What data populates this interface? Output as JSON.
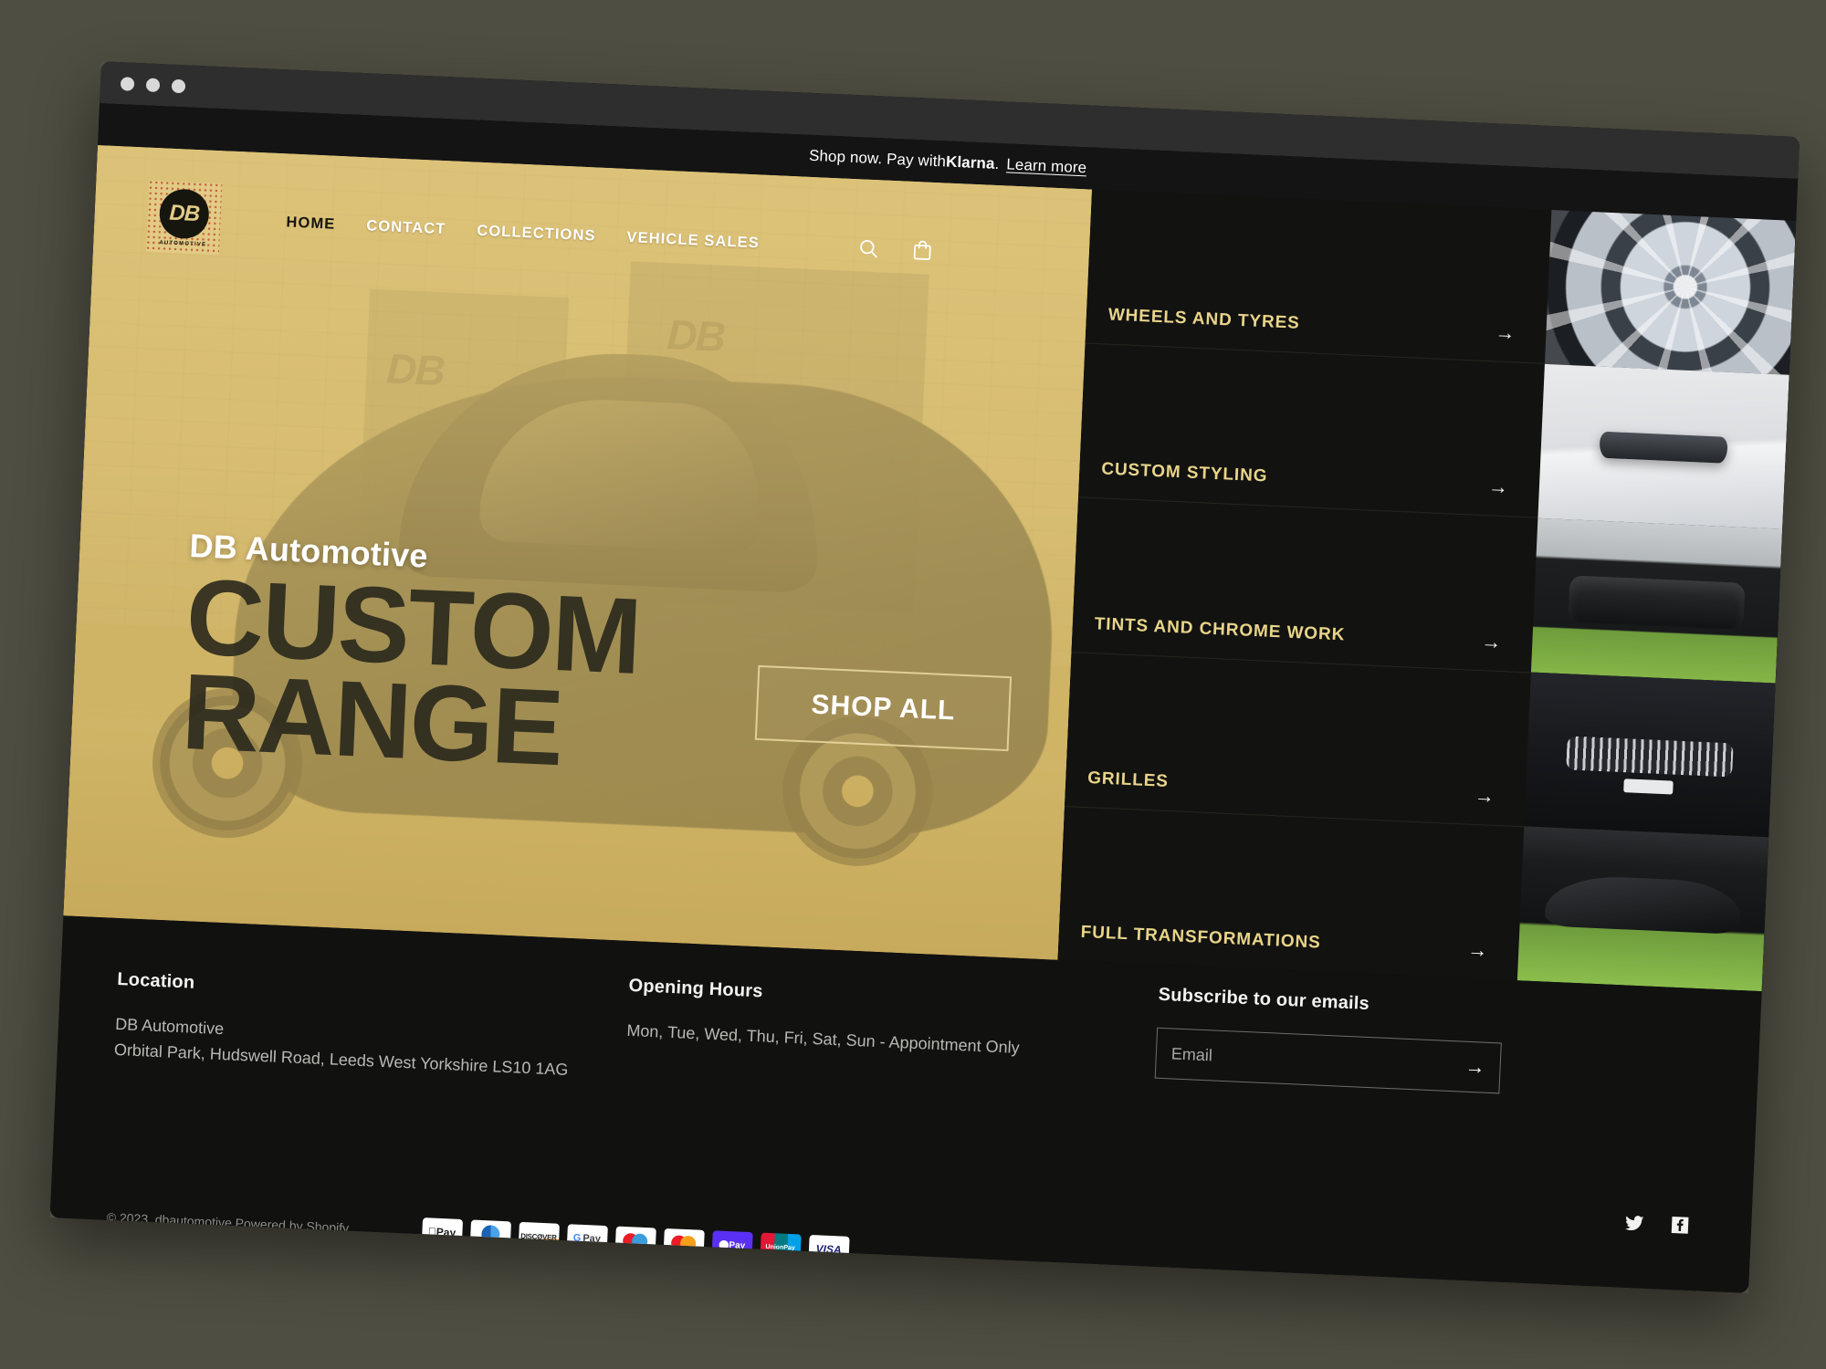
{
  "announcement": {
    "text_before": "Shop now. Pay with ",
    "brand": "Klarna",
    "text_after": ".",
    "link_label": "Learn more"
  },
  "header": {
    "logo": {
      "mark": "DB",
      "sub": "AUTOMOTIVE"
    },
    "nav": [
      {
        "label": "HOME",
        "active": true
      },
      {
        "label": "CONTACT",
        "active": false
      },
      {
        "label": "COLLECTIONS",
        "active": false
      },
      {
        "label": "VEHICLE SALES",
        "active": false
      }
    ],
    "icons": [
      {
        "name": "search-icon"
      },
      {
        "name": "cart-icon"
      }
    ]
  },
  "hero": {
    "eyebrow": "DB Automotive",
    "line1": "CUSTOM",
    "line2": "RANGE",
    "cta_label": "SHOP ALL"
  },
  "categories": [
    {
      "label": "WHEELS AND TYRES",
      "arrow": "→",
      "thumb": "alloy-wheel"
    },
    {
      "label": "CUSTOM STYLING",
      "arrow": "→",
      "thumb": "door-handle"
    },
    {
      "label": "TINTS AND CHROME WORK",
      "arrow": "→",
      "thumb": "car-rear"
    },
    {
      "label": "GRILLES",
      "arrow": "→",
      "thumb": "car-grille"
    },
    {
      "label": "FULL TRANSFORMATIONS",
      "arrow": "→",
      "thumb": "black-hatchback"
    }
  ],
  "footer": {
    "location": {
      "heading": "Location",
      "name": "DB Automotive",
      "address": "Orbital Park, Hudswell Road, Leeds West Yorkshire LS10 1AG"
    },
    "hours": {
      "heading": "Opening Hours",
      "value": "Mon, Tue, Wed, Thu, Fri, Sat, Sun - Appointment Only"
    },
    "subscribe": {
      "heading": "Subscribe to our emails",
      "placeholder": "Email",
      "value": "",
      "submit_arrow": "→"
    },
    "socials": [
      {
        "name": "twitter-icon"
      },
      {
        "name": "facebook-icon"
      }
    ],
    "copyright": "© 2023, dbautomotive Powered by Shopify",
    "payments": [
      {
        "name": "apple-pay",
        "label": "Pay"
      },
      {
        "name": "diners-club",
        "label": ""
      },
      {
        "name": "discover",
        "label": "DISCØVER"
      },
      {
        "name": "google-pay",
        "label": "Pay"
      },
      {
        "name": "maestro",
        "label": ""
      },
      {
        "name": "mastercard",
        "label": ""
      },
      {
        "name": "shop-pay",
        "label": "Pay"
      },
      {
        "name": "unionpay",
        "label": "UnionPay"
      },
      {
        "name": "visa",
        "label": "VISA"
      }
    ]
  },
  "colors": {
    "gold": "#e8d48a",
    "hero_gold": "#d6bc72",
    "dark": "#121210",
    "footer": "#111110"
  }
}
